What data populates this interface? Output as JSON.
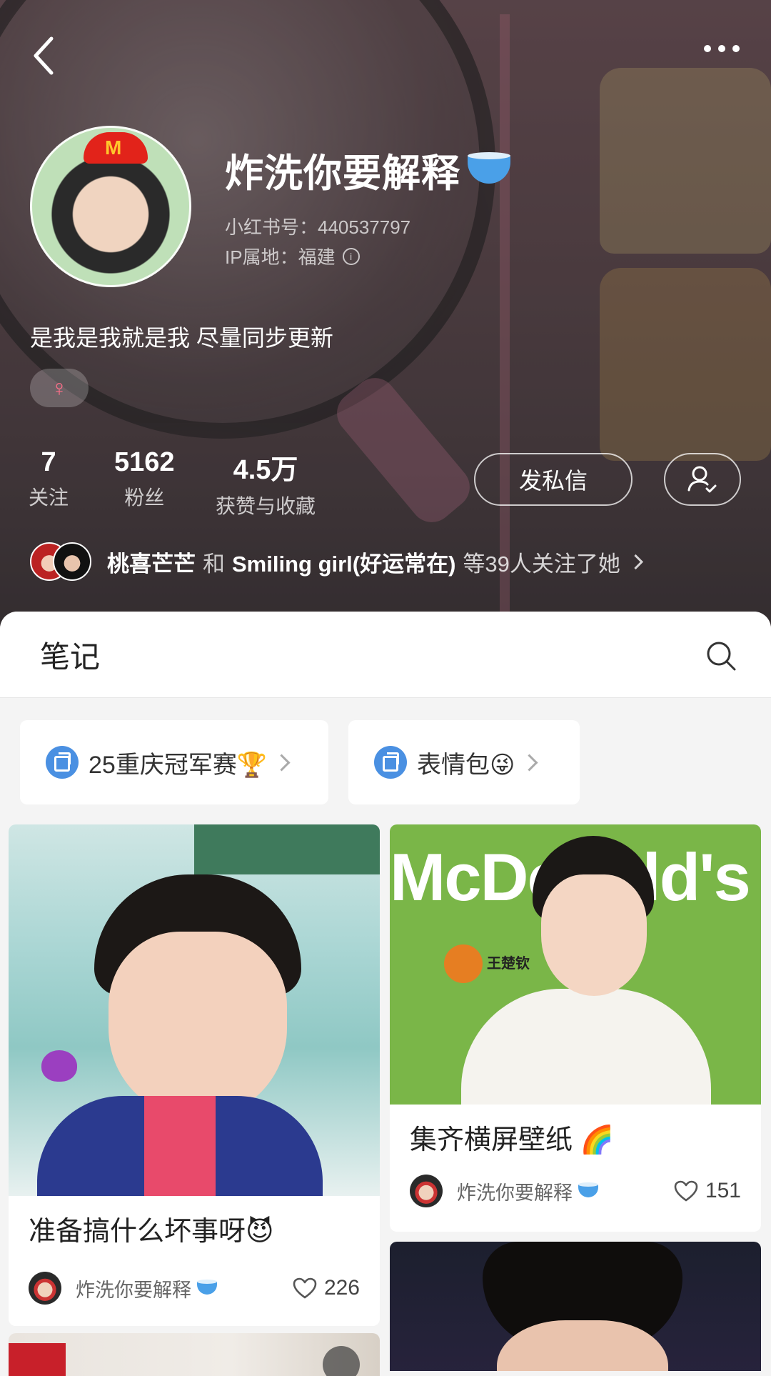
{
  "profile": {
    "name": "炸洗你要解释",
    "red_id": "小红书号：440537797",
    "ip": "IP属地：福建",
    "bio": "是我是我就是我 尽量同步更新",
    "gender_symbol": "♀"
  },
  "stats": [
    {
      "num": "7",
      "label": "关注"
    },
    {
      "num": "5162",
      "label": "粉丝"
    },
    {
      "num": "4.5万",
      "label": "获赞与收藏"
    }
  ],
  "actions": {
    "message": "发私信"
  },
  "mutual": {
    "name1": "桃喜芒芒",
    "and": "和",
    "name2": "Smiling girl(好运常在)",
    "tail": "等39人关注了她"
  },
  "tabs": {
    "notes": "笔记"
  },
  "albums": [
    {
      "label": "25重庆冠军赛🏆"
    },
    {
      "label": "表情包😜"
    }
  ],
  "notes": [
    {
      "title": "准备搞什么坏事呀😈",
      "author": "炸洗你要解释",
      "likes": "226"
    },
    {
      "title": "集齐横屏壁纸 🌈",
      "author": "炸洗你要解释",
      "likes": "151",
      "image_text": "McDonald's",
      "badge": "王楚钦"
    }
  ],
  "icons": {
    "back": "back-chevron-icon",
    "more": "more-dots-icon",
    "info": "info-icon",
    "follow": "followed-user-icon",
    "search": "search-icon",
    "heart": "heart-icon",
    "album": "album-icon"
  },
  "colors": {
    "accent_blue": "#4a90e2",
    "gender_pink": "#ff6f8a"
  }
}
